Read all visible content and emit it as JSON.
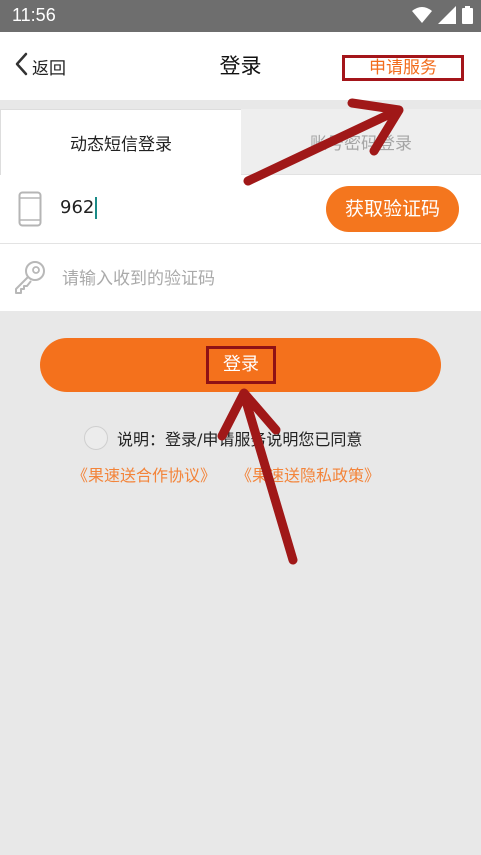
{
  "status_bar": {
    "time": "11:56",
    "icons": [
      "wifi-icon",
      "signal-icon",
      "battery-icon"
    ]
  },
  "navbar": {
    "back_label": "返回",
    "title": "登录",
    "apply_label": "申请服务"
  },
  "tabs": [
    {
      "label": "动态短信登录",
      "active": true
    },
    {
      "label": "账号密码登录",
      "active": false
    }
  ],
  "phone_field": {
    "value": "962",
    "get_code_label": "获取验证码"
  },
  "code_field": {
    "placeholder": "请输入收到的验证码"
  },
  "login_button": {
    "label": "登录"
  },
  "agreement": {
    "text": "说明：登录/申请服务说明您已同意",
    "links": [
      "《果速送合作协议》",
      "《果速送隐私政策》"
    ]
  },
  "colors": {
    "accent": "#f4711c",
    "annotation": "#a4151a",
    "background": "#e8e8e8"
  }
}
